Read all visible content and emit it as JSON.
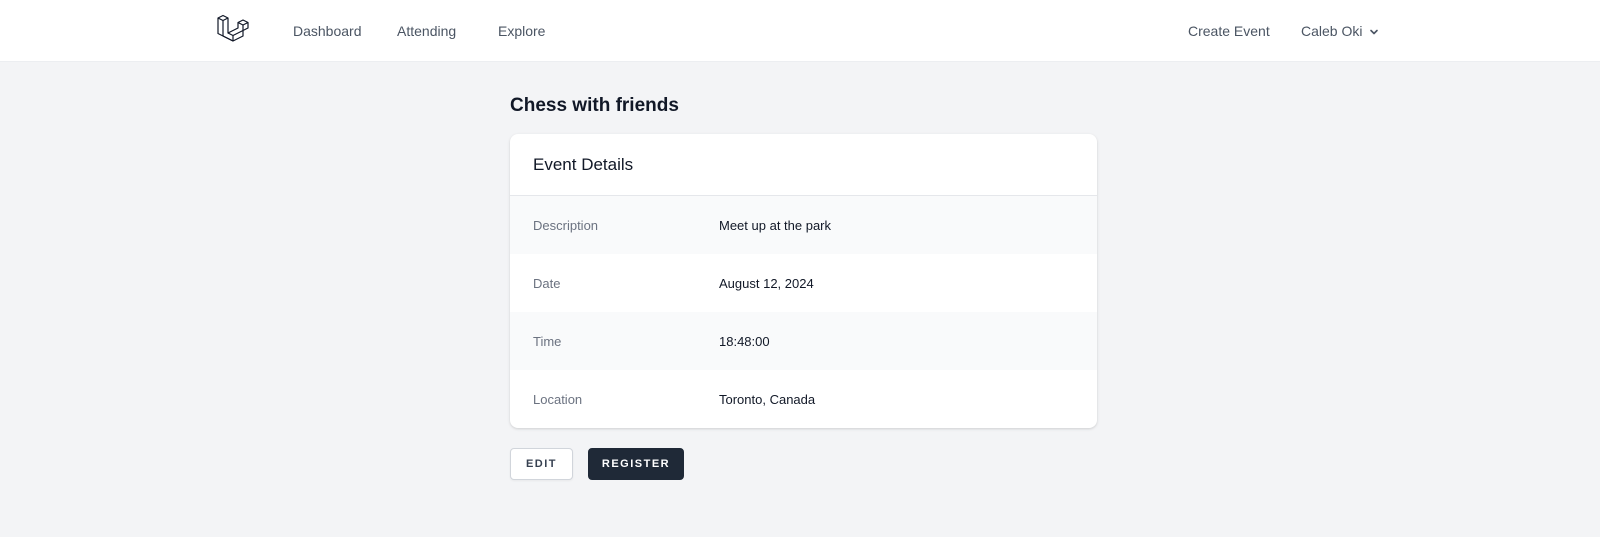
{
  "nav": {
    "links": [
      "Dashboard",
      "Attending",
      "Explore"
    ],
    "create_event": "Create Event",
    "user_name": "Caleb Oki",
    "logo_icon": "laravel-logo-icon",
    "user_menu_icon": "chevron-down-icon"
  },
  "page": {
    "title": "Chess with friends"
  },
  "card": {
    "header": "Event Details",
    "rows": [
      {
        "label": "Description",
        "value": "Meet up at the park"
      },
      {
        "label": "Date",
        "value": "August 12, 2024"
      },
      {
        "label": "Time",
        "value": "18:48:00"
      },
      {
        "label": "Location",
        "value": "Toronto, Canada"
      }
    ]
  },
  "actions": {
    "edit_label": "EDIT",
    "register_label": "REGISTER"
  },
  "colors": {
    "background": "#f3f4f6",
    "primary_button": "#1f2937",
    "text_muted": "#6b7280"
  }
}
